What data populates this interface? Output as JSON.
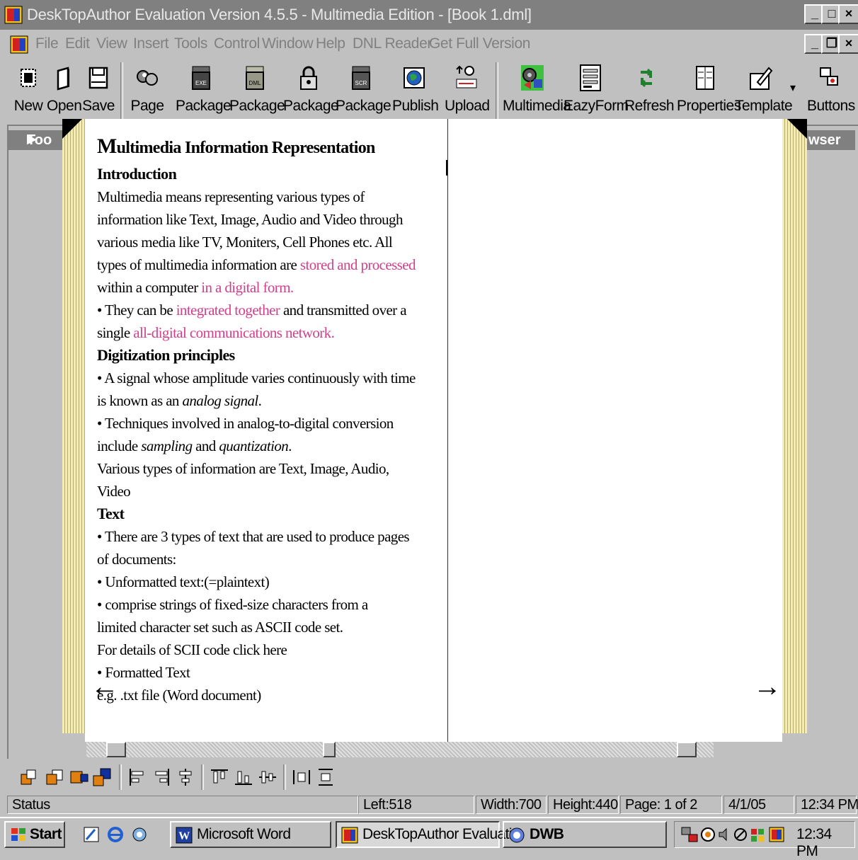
{
  "window": {
    "title": "DeskTopAuthor Evaluation Version 4.5.5 - Multimedia Edition - [Book 1.dml]"
  },
  "menu": [
    "File",
    "Edit",
    "View",
    "Insert",
    "Tools",
    "Control",
    "Window",
    "Help",
    "DNL Reader",
    "Get Full Version"
  ],
  "toolbar": [
    "New",
    "Open",
    "Save",
    "Page",
    "Package",
    "Package",
    "Package",
    "Package",
    "Publish",
    "Upload",
    "Multimedia",
    "EazyForm",
    "Refresh",
    "Properties",
    "Template",
    "Buttons"
  ],
  "side_tabs": {
    "left": "Too",
    "right": "wser"
  },
  "page": {
    "title_cap": "M",
    "title_rest": "ultimedia Information Representation",
    "intro_head": "Introduction",
    "intro_l1": "Multimedia means representing various types of",
    "intro_l2": "information like Text, Image, Audio and Video through",
    "intro_l3": "various media like TV, Moniters, Cell Phones etc. All",
    "intro_l4a": "types of multimedia information are ",
    "intro_l4b": "stored and processed",
    "intro_l5a": "within a computer ",
    "intro_l5b": "in a digital form.",
    "intro_l6a": "• They can be ",
    "intro_l6b": "integrated together",
    "intro_l6c": " and transmitted over a",
    "intro_l7a": "single ",
    "intro_l7b": "all-digital communications network.",
    "dig_head": "Digitization principles",
    "dig_l1": "• A signal whose amplitude varies continuously with time",
    "dig_l2a": "is known as an ",
    "dig_l2b": "analog signal",
    "dig_l2c": ".",
    "dig_l3": "• Techniques involved in analog-to-digital conversion",
    "dig_l4a": "include ",
    "dig_l4b": "sampling",
    "dig_l4c": " and ",
    "dig_l4d": "quantization",
    "dig_l4e": ".",
    "dig_l5": "Various types of information are Text, Image, Audio,",
    "dig_l6": "Video",
    "text_head": "Text",
    "text_l1": "• There are 3 types of text that are used to produce pages",
    "text_l2": "of documents:",
    "text_l3": "• Unformatted text:(=plaintext)",
    "text_l4": "• comprise strings of fixed-size characters from a",
    "text_l5": "limited character set such as ASCII code set.",
    "text_l6": "For details of SCII code click here",
    "text_l7": "• Formatted Text",
    "text_l8": "e.g. .txt file (Word document)"
  },
  "status": {
    "label": "Status",
    "left": "Left:518",
    "width": "Width:700",
    "height": "Height:440",
    "page": "Page: 1 of 2",
    "date": "4/1/05",
    "time": "12:34 PM"
  },
  "taskbar": {
    "start": "Start",
    "word": "Microsoft Word",
    "dta": "DeskTopAuthor Evaluati...",
    "dwb": "DWB",
    "clock": "12:34 PM"
  },
  "colors": {
    "link_pink": "#d1408c",
    "page_edge": "#f4ecb2",
    "titlebar": "#808080"
  }
}
